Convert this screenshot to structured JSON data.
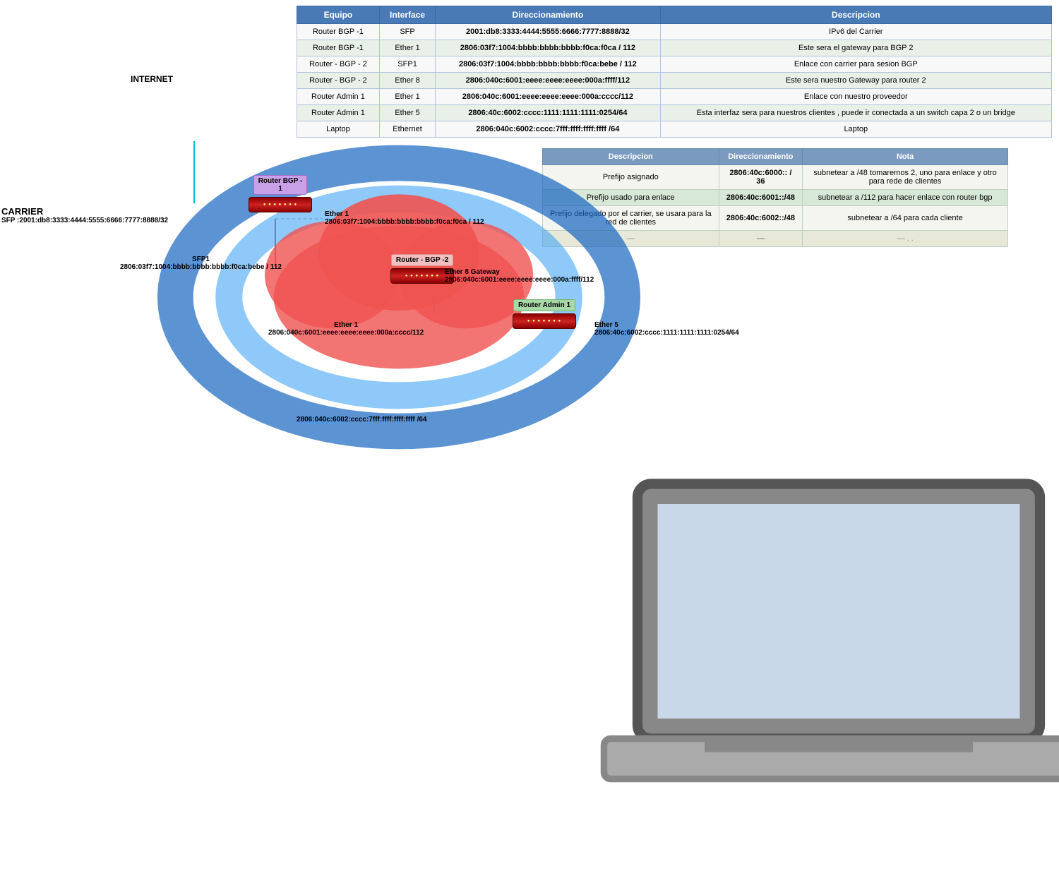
{
  "main_table": {
    "headers": [
      "Equipo",
      "Interface",
      "Direccionamiento",
      "Descripcion"
    ],
    "rows": [
      {
        "equipo": "Router BGP -1",
        "interface": "SFP",
        "direccionamiento": "2001:db8:3333:4444:5555:6666:7777:8888/32",
        "descripcion": "IPv6 del Carrier"
      },
      {
        "equipo": "Router BGP -1",
        "interface": "Ether 1",
        "direccionamiento": "2806:03f7:1004:bbbb:bbbb:bbbb:f0ca:f0ca / 112",
        "descripcion": "Este sera el gateway para BGP 2"
      },
      {
        "equipo": "Router - BGP - 2",
        "interface": "SFP1",
        "direccionamiento": "2806:03f7:1004:bbbb:bbbb:bbbb:f0ca:bebe / 112",
        "descripcion": "Enlace con carrier para sesion BGP"
      },
      {
        "equipo": "Router - BGP - 2",
        "interface": "Ether 8",
        "direccionamiento": "2806:040c:6001:eeee:eeee:eeee:000a:ffff/112",
        "descripcion": "Este sera nuestro Gateway para router 2"
      },
      {
        "equipo": "Router Admin 1",
        "interface": "Ether 1",
        "direccionamiento": "2806:040c:6001:eeee:eeee:eeee:000a:cccc/112",
        "descripcion": "Enlace con nuestro proveedor"
      },
      {
        "equipo": "Router Admin 1",
        "interface": "Ether 5",
        "direccionamiento": "2806:40c:6002:cccc:1111:1111:1111:0254/64",
        "descripcion": "Esta interfaz sera para nuestros clientes , puede ir conectada a un switch capa 2 o un bridge"
      },
      {
        "equipo": "Laptop",
        "interface": "Ethernet",
        "direccionamiento": "2806:040c:6002:cccc:7fff:ffff:ffff:ffff /64",
        "descripcion": "Laptop"
      }
    ]
  },
  "sec_table": {
    "headers": [
      "Descripcion",
      "Direccionamiento",
      "Nota"
    ],
    "rows": [
      {
        "desc": "Prefijo asignado",
        "dir": "2806:40c:6000:: / 36",
        "nota": "subnetear a /48  tomaremos 2, uno para enlace y otro para rede de clientes"
      },
      {
        "desc": "Prefijo usado para enlace",
        "dir": "2806:40c:6001::/48",
        "nota": "subnetear a /112 para hacer enlace con router bgp"
      },
      {
        "desc": "Prefijo delegado por el carrier, se usara para la red de clientes",
        "dir": "2806:40c:6002::/48",
        "nota": "subnetear a /64 para cada cliente"
      },
      {
        "desc": "—",
        "dir": "—",
        "nota": "— . ."
      }
    ]
  },
  "diagram": {
    "internet_label": "INTERNET",
    "carrier_label": "CARRIER",
    "carrier_sfp": "SFP :2001:db8:3333:4444:5555:6666:7777:8888/32",
    "router_bgp1_label": "Router BGP -\n1",
    "router_bgp1_ether1": "Ether 1",
    "router_bgp1_ether1_addr": "2806:03f7:1004:bbbb:bbbb:bbbb:f0ca:f0ca / 112",
    "router_bgp2_label": "Router - BGP -2",
    "router_bgp2_sfp1": "SFP1",
    "router_bgp2_sfp1_addr": "2806:03f7:1004:bbbb:bbbb:bbbb:f0ca:bebe / 112",
    "router_bgp2_ether8": "Ether 8 Gateway",
    "router_bgp2_ether8_addr": "2806:040c:6001:eeee:eeee:eeee:000a:ffff/112",
    "router_admin1_label": "Router Admin 1",
    "router_admin1_ether1": "Ether 1",
    "router_admin1_ether1_addr": "2806:040c:6001:eeee:eeee:eeee:000a:cccc/112",
    "router_admin1_ether5": "Ether 5",
    "router_admin1_ether5_addr": "2806:40c:6002:cccc:1111:1111:1111:0254/64",
    "laptop_addr": "2806:040c:6002:cccc:7fff:ffff:ffff:ffff /64"
  }
}
